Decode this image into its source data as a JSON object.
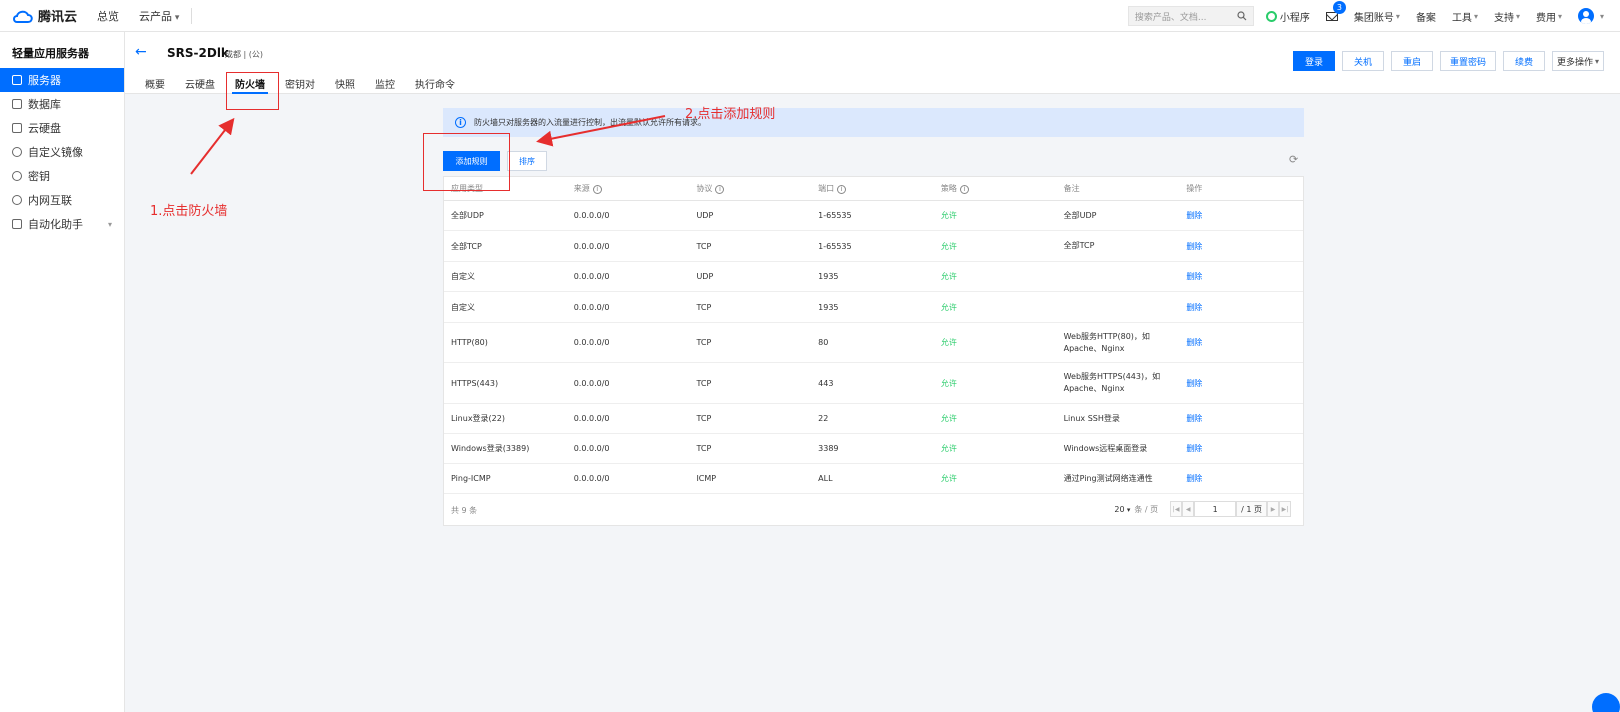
{
  "topnav": {
    "brand": "腾讯云",
    "links": [
      "总览",
      "云产品"
    ],
    "search_placeholder": "搜索产品、文档...",
    "right_items": {
      "miniprogram": "小程序",
      "mail_badge": "3",
      "account": "集团账号",
      "filing": "备案",
      "tools": "工具",
      "support": "支持",
      "billing": "费用"
    }
  },
  "sidebar": {
    "title": "轻量应用服务器",
    "items": [
      {
        "label": "服务器",
        "active": true
      },
      {
        "label": "数据库"
      },
      {
        "label": "云硬盘"
      },
      {
        "label": "自定义镜像"
      },
      {
        "label": "密钥"
      },
      {
        "label": "内网互联"
      },
      {
        "label": "自动化助手"
      }
    ]
  },
  "header": {
    "server_name": "SRS-2Dlk",
    "region": "成都 | (公)",
    "tabs": [
      "概要",
      "云硬盘",
      "防火墙",
      "密钥对",
      "快照",
      "监控",
      "执行命令"
    ],
    "active_tab": "防火墙",
    "buttons": [
      "登录",
      "关机",
      "重启",
      "重置密码",
      "续费",
      "更多操作"
    ]
  },
  "notice": {
    "text": "防火墙只对服务器的入流量进行控制，出流量默认允许所有请求。"
  },
  "toolbar": {
    "add_rule": "添加规则",
    "sort": "排序"
  },
  "table": {
    "headers": [
      "应用类型",
      "来源",
      "协议",
      "端口",
      "策略",
      "备注",
      "操作"
    ],
    "rows": [
      {
        "app": "全部UDP",
        "source": "0.0.0.0/0",
        "protocol": "UDP",
        "port": "1-65535",
        "policy": "允许",
        "note": "全部UDP",
        "action": "删除"
      },
      {
        "app": "全部TCP",
        "source": "0.0.0.0/0",
        "protocol": "TCP",
        "port": "1-65535",
        "policy": "允许",
        "note": "全部TCP",
        "action": "删除"
      },
      {
        "app": "自定义",
        "source": "0.0.0.0/0",
        "protocol": "UDP",
        "port": "1935",
        "policy": "允许",
        "note": "",
        "action": "删除"
      },
      {
        "app": "自定义",
        "source": "0.0.0.0/0",
        "protocol": "TCP",
        "port": "1935",
        "policy": "允许",
        "note": "",
        "action": "删除"
      },
      {
        "app": "HTTP(80)",
        "source": "0.0.0.0/0",
        "protocol": "TCP",
        "port": "80",
        "policy": "允许",
        "note": "Web服务HTTP(80)，如 Apache、Nginx",
        "action": "删除"
      },
      {
        "app": "HTTPS(443)",
        "source": "0.0.0.0/0",
        "protocol": "TCP",
        "port": "443",
        "policy": "允许",
        "note": "Web服务HTTPS(443)，如 Apache、Nginx",
        "action": "删除"
      },
      {
        "app": "Linux登录(22)",
        "source": "0.0.0.0/0",
        "protocol": "TCP",
        "port": "22",
        "policy": "允许",
        "note": "Linux SSH登录",
        "action": "删除"
      },
      {
        "app": "Windows登录(3389)",
        "source": "0.0.0.0/0",
        "protocol": "TCP",
        "port": "3389",
        "policy": "允许",
        "note": "Windows远程桌面登录",
        "action": "删除"
      },
      {
        "app": "Ping-ICMP",
        "source": "0.0.0.0/0",
        "protocol": "ICMP",
        "port": "ALL",
        "policy": "允许",
        "note": "通过Ping测试网络连通性",
        "action": "删除"
      }
    ],
    "footer": {
      "total": "共 9 条",
      "page_size": "20",
      "page_size_suffix": "条 / 页",
      "current_page": "1",
      "total_pages": "/ 1 页"
    }
  },
  "annotations": {
    "step1": "1.点击防火墙",
    "step2": "2.点击添加规则",
    "color": "#e62e2e"
  },
  "colors": {
    "primary": "#006eff",
    "allow": "#29cc6a"
  }
}
